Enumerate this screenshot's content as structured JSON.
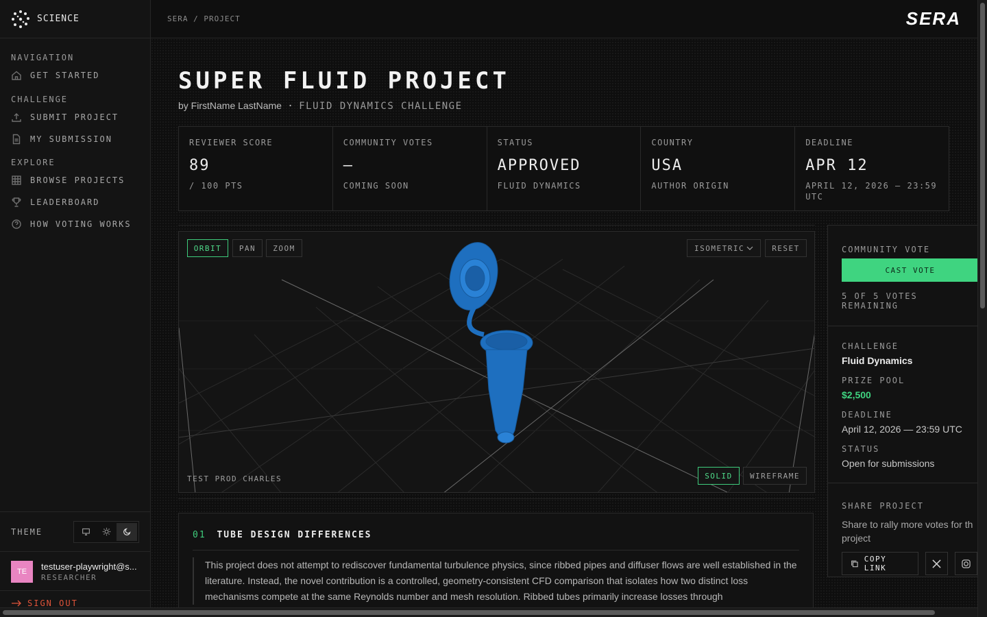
{
  "brand": {
    "name": "SCIENCE",
    "logo": "SERA"
  },
  "breadcrumb": "SERA / PROJECT",
  "sidebar": {
    "sections": [
      {
        "heading": "NAVIGATION",
        "items": [
          {
            "label": "GET STARTED",
            "icon": "home-icon"
          }
        ]
      },
      {
        "heading": "CHALLENGE",
        "items": [
          {
            "label": "SUBMIT PROJECT",
            "icon": "upload-icon"
          },
          {
            "label": "MY SUBMISSION",
            "icon": "document-icon"
          }
        ]
      },
      {
        "heading": "EXPLORE",
        "items": [
          {
            "label": "BROWSE PROJECTS",
            "icon": "grid-icon"
          },
          {
            "label": "LEADERBOARD",
            "icon": "trophy-icon"
          },
          {
            "label": "HOW VOTING WORKS",
            "icon": "help-circle-icon"
          }
        ]
      }
    ],
    "theme_label": "THEME",
    "theme_active": "dark",
    "user": {
      "initials": "TE",
      "email": "testuser-playwright@s...",
      "role": "RESEARCHER",
      "avatar_color": "#e985c2"
    },
    "signout": "SIGN OUT"
  },
  "project": {
    "title": "SUPER FLUID PROJECT",
    "byline_author": "by FirstName LastName",
    "byline_sep": "·",
    "byline_challenge": "FLUID DYNAMICS CHALLENGE"
  },
  "stats": [
    {
      "label": "REVIEWER SCORE",
      "value": "89",
      "sub": "/ 100 PTS"
    },
    {
      "label": "COMMUNITY VOTES",
      "value": "—",
      "sub": "COMING SOON"
    },
    {
      "label": "STATUS",
      "value": "APPROVED",
      "sub": "FLUID DYNAMICS"
    },
    {
      "label": "COUNTRY",
      "value": "USA",
      "sub": "AUTHOR ORIGIN"
    },
    {
      "label": "DEADLINE",
      "value": "APR 12",
      "sub": "APRIL 12, 2026 — 23:59 UTC"
    }
  ],
  "viewer": {
    "modes": [
      "ORBIT",
      "PAN",
      "ZOOM"
    ],
    "active_mode": "ORBIT",
    "view_select": "ISOMETRIC",
    "reset": "RESET",
    "render_modes": [
      "SOLID",
      "WIREFRAME"
    ],
    "active_render": "SOLID",
    "model_label": "TEST PROD CHARLES",
    "model_color": "#1e6fbf"
  },
  "section": {
    "number": "01",
    "title": "TUBE DESIGN DIFFERENCES",
    "body": "This project does not attempt to rediscover fundamental turbulence physics, since ribbed pipes and diffuser flows are well established in the literature. Instead, the novel contribution is a controlled, geometry-consistent CFD comparison that isolates how two distinct loss mechanisms compete at the same Reynolds number and mesh resolution. Ribbed tubes primarily increase losses through"
  },
  "right_panel": {
    "vote_label": "COMMUNITY VOTE",
    "cast_vote": "CAST VOTE",
    "votes_remaining": "5 OF 5 VOTES REMAINING",
    "challenge_label": "CHALLENGE",
    "challenge_value": "Fluid Dynamics",
    "prize_label": "PRIZE POOL",
    "prize_value": "$2,500",
    "deadline_label": "DEADLINE",
    "deadline_value": "April 12, 2026 — 23:59 UTC",
    "status_label": "STATUS",
    "status_value": "Open for submissions",
    "share_label": "SHARE PROJECT",
    "share_text_1": "Share to rally more votes for th",
    "share_text_2": "project",
    "copy_link": "COPY LINK"
  },
  "colors": {
    "accent": "#3fd480",
    "danger": "#e0543a",
    "background": "#0d0d0d"
  }
}
